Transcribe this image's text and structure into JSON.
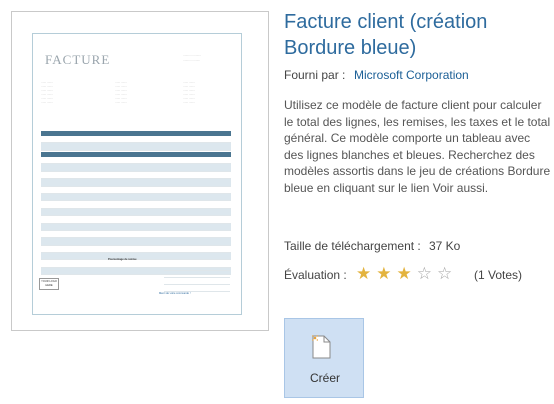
{
  "template": {
    "title": "Facture client (création Bordure bleue)",
    "provided_by_label": "Fourni par :",
    "provider": "Microsoft Corporation",
    "description": "Utilisez ce modèle de facture client pour calculer le total des lignes, les remises, les taxes et le total général. Ce modèle comporte un tableau avec des lignes blanches et bleues. Recherchez des modèles assortis dans le jeu de créations Bordure bleue en cliquant sur le lien Voir aussi.",
    "download_size_label": "Taille de téléchargement :",
    "download_size": "37 Ko",
    "rating_label": "Évaluation :",
    "rating": 3,
    "rating_max": 5,
    "votes": "(1 Votes)"
  },
  "create_button": {
    "label": "Créer"
  },
  "preview": {
    "heading": "FACTURE",
    "logo": "YOUR LOGO HERE",
    "table_total_label": "Pourcentage de remise",
    "closing": "Merci de votre commande !"
  },
  "colors": {
    "accent_title": "#2e6b9e",
    "link": "#1b5f96",
    "button_bg": "#cfe0f3",
    "star": "#e3b33e",
    "doc_band": "#4a7590"
  },
  "icons": {
    "create": "new-document-icon",
    "star_full": "star-filled-icon",
    "star_empty": "star-outline-icon"
  }
}
